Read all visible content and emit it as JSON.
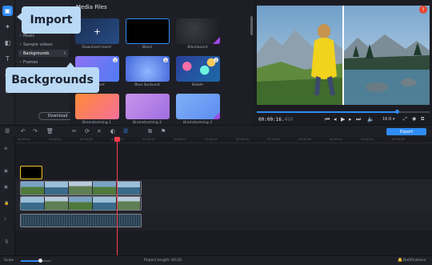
{
  "callouts": {
    "import": "Import",
    "backgrounds": "Backgrounds"
  },
  "categories": [
    {
      "label": "Music"
    },
    {
      "label": "Sample videos"
    },
    {
      "label": "Backgrounds",
      "count": "8"
    },
    {
      "label": "Frames"
    }
  ],
  "download_label": "Download",
  "media": {
    "title": "Media Files",
    "tiles": [
      {
        "label": "Download more!"
      },
      {
        "label": "Black"
      },
      {
        "label": "Blackboard"
      },
      {
        "label": "Gradient"
      },
      {
        "label": "Blue Sunburst"
      },
      {
        "label": "Bokeh"
      },
      {
        "label": "Brainstorming 1"
      },
      {
        "label": "Brainstorming 2"
      },
      {
        "label": "Brainstorming 3"
      }
    ]
  },
  "preview": {
    "time_current": "00:00:16.",
    "time_fraction": "450",
    "aspect_ratio": "16:9 ▾",
    "help": "?",
    "progress": 0.81
  },
  "toolbar": {
    "export_label": "Export"
  },
  "ruler_ticks": [
    "00:00:00",
    "00:00:04",
    "00:00:08",
    "00:00:12",
    "00:00:16",
    "00:00:20",
    "00:00:24",
    "00:00:28",
    "00:00:32",
    "00:00:36",
    "00:00:40",
    "00:00:44",
    "00:00:48"
  ],
  "status": {
    "scale_label": "Scale",
    "project_length_label": "Project length:",
    "project_length_value": "00:20",
    "notifications_label": "Notifications",
    "zoom_level": 0.62
  },
  "colors": {
    "accent": "#2f8bf5",
    "playhead": "#ff3b4d",
    "callout": "#b9d9f5",
    "selection": "#f3c51b",
    "premium": "#9f48e6"
  }
}
